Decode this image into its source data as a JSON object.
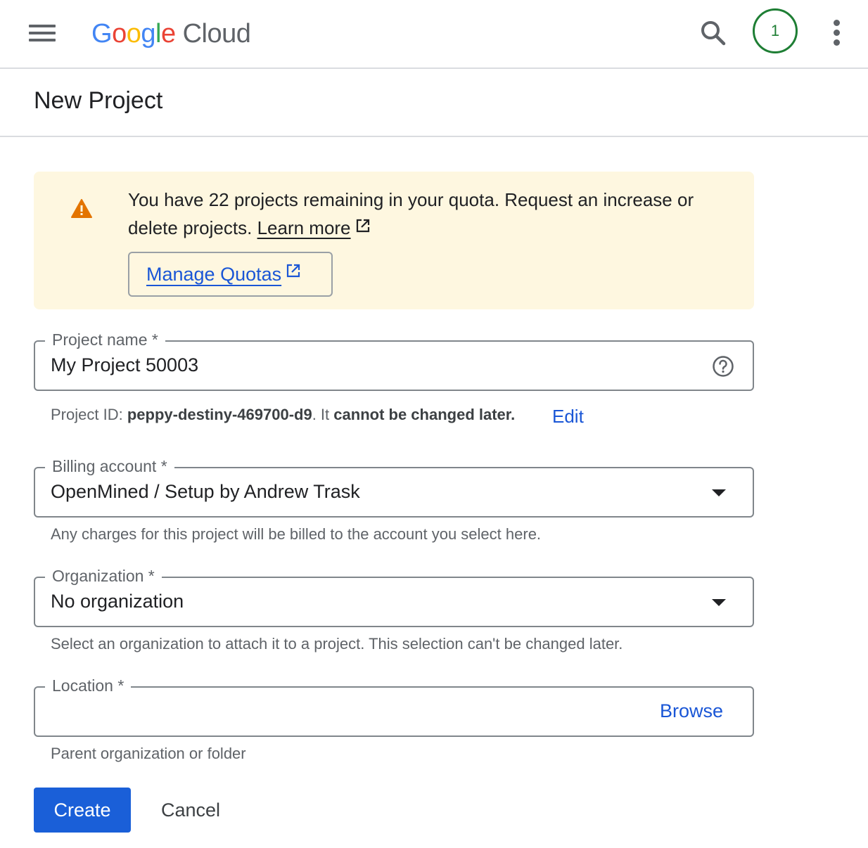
{
  "topbar": {
    "logo": {
      "google_letters": [
        "G",
        "o",
        "o",
        "g",
        "l",
        "e"
      ],
      "google_colors": [
        "#4285F4",
        "#EA4335",
        "#FBBC05",
        "#4285F4",
        "#34A853",
        "#EA4335"
      ],
      "product": "Cloud"
    },
    "menu_icon": "hamburger-menu-icon",
    "search_icon": "search-icon",
    "avatar_text": "1",
    "more_icon": "more-vert-icon"
  },
  "page": {
    "title": "New Project"
  },
  "banner": {
    "icon": "warning-icon",
    "text": "You have 22 projects remaining in your quota. Request an increase or delete projects.",
    "learn_more": "Learn more",
    "manage_quotas": "Manage Quotas"
  },
  "form": {
    "project_name": {
      "label": "Project name *",
      "value": "My Project 50003",
      "help_icon": "help-icon"
    },
    "project_id": {
      "prefix": "Project ID:",
      "id": "peppy-destiny-469700-d9",
      "separator": ". It",
      "note": "cannot be changed later.",
      "edit": "Edit"
    },
    "billing": {
      "label": "Billing account *",
      "value": "OpenMined / Setup by Andrew Trask",
      "hint": "Any charges for this project will be billed to the account you select here."
    },
    "organization": {
      "label": "Organization *",
      "value": "No organization",
      "hint": "Select an organization to attach it to a project. This selection can't be changed later."
    },
    "location": {
      "label": "Location *",
      "value": "",
      "browse": "Browse",
      "hint": "Parent organization or folder"
    }
  },
  "actions": {
    "create": "Create",
    "cancel": "Cancel"
  },
  "colors": {
    "primary_blue": "#1a5fd8",
    "link_blue": "#1a56d6",
    "banner_bg": "#fef7e0",
    "warning_orange": "#e37400",
    "avatar_green": "#1e7e34"
  }
}
